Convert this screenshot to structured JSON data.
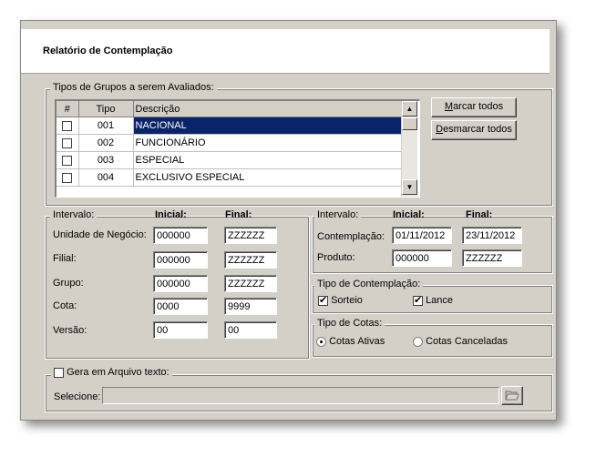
{
  "header": {
    "title": "Relatório de Contemplação"
  },
  "groups_section": {
    "legend": "Tipos de Grupos a serem Avaliados:",
    "columns": [
      "#",
      "Tipo",
      "Descrição"
    ],
    "rows": [
      {
        "tipo": "001",
        "descricao": "NACIONAL",
        "selected": true
      },
      {
        "tipo": "002",
        "descricao": "FUNCIONÁRIO"
      },
      {
        "tipo": "003",
        "descricao": "ESPECIAL"
      },
      {
        "tipo": "004",
        "descricao": "EXCLUSIVO ESPECIAL"
      }
    ],
    "mark_all_label": "Marcar todos",
    "unmark_all_label": "Desmarcar todos"
  },
  "left_interval": {
    "legend": "Intervalo:",
    "initial_header": "Inicial:",
    "final_header": "Final:",
    "rows": [
      {
        "label": "Unidade de Negócio:",
        "initial": "000000",
        "final": "ZZZZZZ"
      },
      {
        "label": "Filial:",
        "initial": "000000",
        "final": "ZZZZZZ"
      },
      {
        "label": "Grupo:",
        "initial": "000000",
        "final": "ZZZZZZ"
      },
      {
        "label": "Cota:",
        "initial": "0000",
        "final": "9999"
      },
      {
        "label": "Versão:",
        "initial": "00",
        "final": "00"
      }
    ]
  },
  "right_interval": {
    "legend": "Intervalo:",
    "initial_header": "Inicial:",
    "final_header": "Final:",
    "rows": [
      {
        "label": "Contemplação:",
        "initial": "01/11/2012",
        "final": "23/11/2012"
      },
      {
        "label": "Produto:",
        "initial": "000000",
        "final": "ZZZZZZ"
      }
    ]
  },
  "contemplation_type": {
    "legend": "Tipo de Contemplação:",
    "sorteio_label": "Sorteio",
    "lance_label": "Lance"
  },
  "quota_type": {
    "legend": "Tipo de Cotas:",
    "active_label": "Cotas Ativas",
    "cancelled_label": "Cotas Canceladas"
  },
  "export": {
    "legend": "Gera em Arquivo texto:",
    "select_label": "Selecione:",
    "path_value": ""
  },
  "icons": {
    "browse": "folder-open-icon",
    "scroll_up": "arrow-up-icon",
    "scroll_down": "arrow-down-icon"
  }
}
